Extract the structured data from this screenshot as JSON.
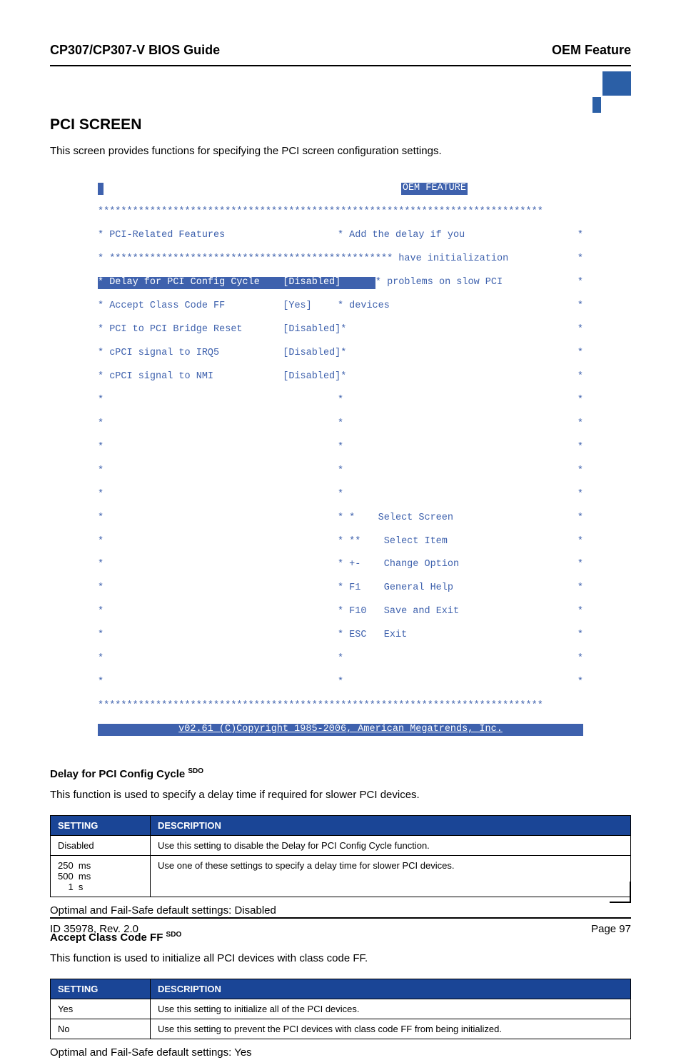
{
  "header": {
    "left": "CP307/CP307-V BIOS Guide",
    "right": "OEM Feature"
  },
  "section": {
    "title": "PCI SCREEN",
    "intro": "This screen provides functions for specifying the PCI screen configuration settings."
  },
  "bios": {
    "title": "OEM FEATURE",
    "group_label": "PCI-Related Features",
    "rows": [
      {
        "label": "Delay for PCI Config Cycle",
        "value": "[Disabled]"
      },
      {
        "label": "Accept Class Code FF",
        "value": "[Yes]"
      },
      {
        "label": "PCI to PCI Bridge Reset",
        "value": "[Disabled]"
      },
      {
        "label": "cPCI signal to IRQ5",
        "value": "[Disabled]"
      },
      {
        "label": "cPCI signal to NMI",
        "value": "[Disabled]"
      }
    ],
    "help": [
      "Add the delay if you",
      "have initialization",
      "problems on slow PCI",
      "devices"
    ],
    "keys": [
      {
        "k": "*",
        "d": "Select Screen"
      },
      {
        "k": "**",
        "d": "Select Item"
      },
      {
        "k": "+-",
        "d": "Change Option"
      },
      {
        "k": "F1",
        "d": "General Help"
      },
      {
        "k": "F10",
        "d": "Save and Exit"
      },
      {
        "k": "ESC",
        "d": "Exit"
      }
    ],
    "copyright": "v02.61 (C)Copyright 1985-2006, American Megatrends, Inc."
  },
  "sub1": {
    "heading": "Delay for PCI Config Cycle",
    "sdo": "SDO",
    "intro": "This function is used to specify a delay time if required for slower PCI devices.",
    "th_setting": "SETTING",
    "th_desc": "DESCRIPTION",
    "r1_setting": "Disabled",
    "r1_desc": "Use this setting to disable the Delay for PCI Config Cycle function.",
    "r2_setting": "250  ms\n500  ms\n    1  s",
    "r2_desc": "Use one of these settings to specify a delay time for slower PCI devices.",
    "default": "Optimal and Fail-Safe default settings: Disabled"
  },
  "sub2": {
    "heading": "Accept Class Code FF",
    "sdo": "SDO",
    "intro": "This function is used to initialize all PCI devices with class code FF.",
    "th_setting": "SETTING",
    "th_desc": "DESCRIPTION",
    "r1_setting": "Yes",
    "r1_desc": "Use this setting to initialize all of the PCI devices.",
    "r2_setting": "No",
    "r2_desc": "Use this setting to prevent the PCI devices with class code FF from being initialized.",
    "default": "Optimal and Fail-Safe default settings: Yes"
  },
  "footer": {
    "left": "ID 35978, Rev. 2.0",
    "right": "Page 97"
  }
}
